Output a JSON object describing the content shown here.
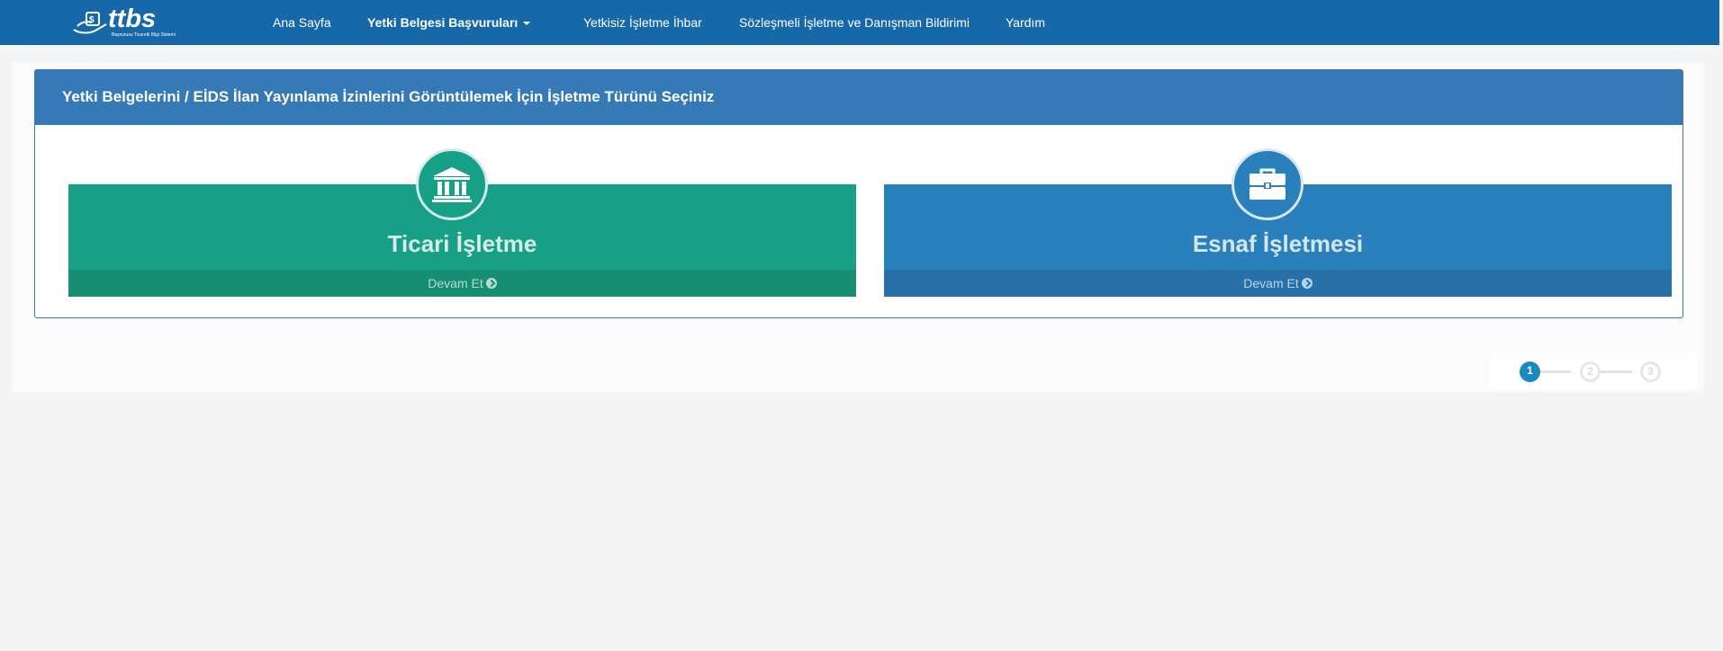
{
  "brand": {
    "logo_text": "ttbs",
    "logo_subtitle": "Başvurusu Ticaretli Bilgi Sistemi"
  },
  "nav": {
    "home": "Ana Sayfa",
    "applications": "Yetki Belgesi Başvuruları",
    "report": "Yetkisiz İşletme İhbar",
    "contract": "Sözleşmeli İşletme ve Danışman Bildirimi",
    "help": "Yardım"
  },
  "panel": {
    "title": "Yetki Belgelerini / EİDS İlan Yayınlama İzinlerini Görüntülemek İçin İşletme Türünü Seçiniz"
  },
  "tiles": [
    {
      "title": "Ticari İşletme",
      "footer": "Devam Et",
      "icon": "bank-icon",
      "color": "#17a085"
    },
    {
      "title": "Esnaf İşletmesi",
      "footer": "Devam Et",
      "icon": "briefcase-icon",
      "color": "#2a80bb"
    }
  ],
  "stepper": {
    "current": 1,
    "steps": [
      "1",
      "2",
      "3"
    ]
  },
  "colors": {
    "navbar": "#1668a8",
    "panel_heading": "#357ab7",
    "step_active": "#1b8bbf"
  }
}
